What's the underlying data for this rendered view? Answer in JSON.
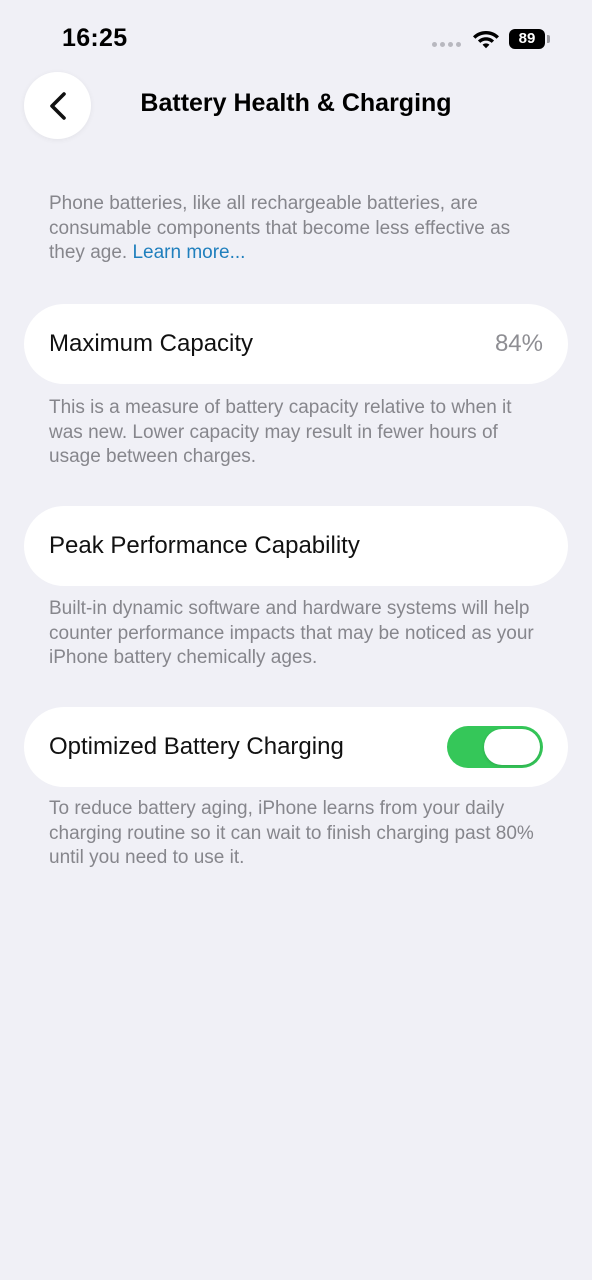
{
  "status_bar": {
    "time": "16:25",
    "battery_level": "89",
    "icons": [
      "signal-dots-icon",
      "wifi-icon",
      "battery-icon"
    ]
  },
  "nav": {
    "back_icon": "chevron-left-icon",
    "title": "Battery Health & Charging"
  },
  "intro": {
    "text": "Phone batteries, like all rechargeable batteries, are consumable components that become less effective as they age. ",
    "link": "Learn more..."
  },
  "max_capacity": {
    "label": "Maximum Capacity",
    "value": "84%",
    "footnote": "This is a measure of battery capacity relative to when it was new. Lower capacity may result in fewer hours of usage between charges."
  },
  "peak_performance": {
    "label": "Peak Performance Capability",
    "footnote": "Built-in dynamic software and hardware systems will help counter performance impacts that may be noticed as your iPhone battery chemically ages."
  },
  "optimized_charging": {
    "label": "Optimized Battery Charging",
    "enabled": true,
    "footnote": "To reduce battery aging, iPhone learns from your daily charging routine so it can wait to finish charging past 80% until you need to use it."
  },
  "colors": {
    "background": "#f0f0f6",
    "card": "#ffffff",
    "toggle_on": "#35c759",
    "link": "#1f7fbd",
    "secondary_text": "#86868c"
  }
}
